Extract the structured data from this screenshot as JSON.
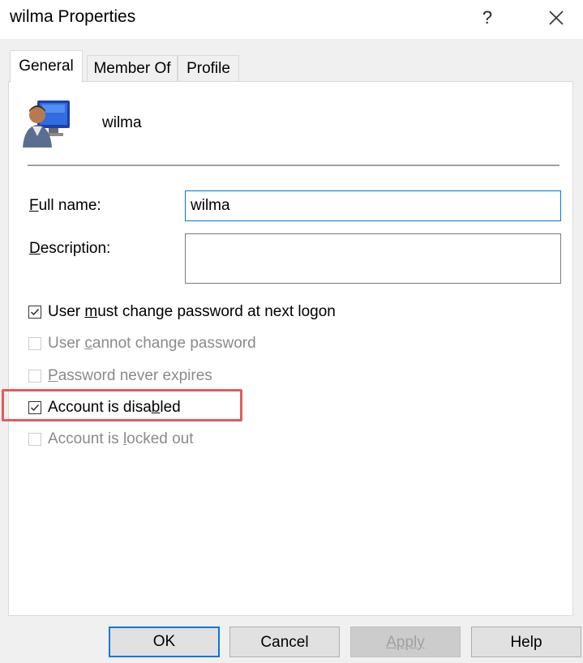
{
  "window": {
    "title": "wilma Properties",
    "help_glyph": "?",
    "close_icon": "close-icon"
  },
  "tabs": [
    {
      "label": "General",
      "active": true
    },
    {
      "label": "Member Of",
      "active": false
    },
    {
      "label": "Profile",
      "active": false
    }
  ],
  "user": {
    "name": "wilma",
    "icon": "user-computer-icon"
  },
  "form": {
    "full_name": {
      "label_mnemonic": "F",
      "label_rest": "ull name:",
      "value": "wilma"
    },
    "description": {
      "label_mnemonic": "D",
      "label_rest": "escription:",
      "value": ""
    }
  },
  "checkboxes": [
    {
      "pre": "User ",
      "mnemonic": "m",
      "post": "ust change password at next logon",
      "checked": true,
      "enabled": true
    },
    {
      "pre": "User ",
      "mnemonic": "c",
      "post": "annot change password",
      "checked": false,
      "enabled": false
    },
    {
      "pre": "",
      "mnemonic": "P",
      "post": "assword never expires",
      "checked": false,
      "enabled": false
    },
    {
      "pre": "Account is disa",
      "mnemonic": "b",
      "post": "led",
      "checked": true,
      "enabled": true,
      "highlighted": true
    },
    {
      "pre": "Account is ",
      "mnemonic": "l",
      "post": "ocked out",
      "checked": false,
      "enabled": false
    }
  ],
  "buttons": {
    "ok": "OK",
    "cancel": "Cancel",
    "apply": "Apply",
    "help": "Help"
  },
  "colors": {
    "focus_accent": "#0078d7",
    "highlight_box": "#e05c5c"
  }
}
